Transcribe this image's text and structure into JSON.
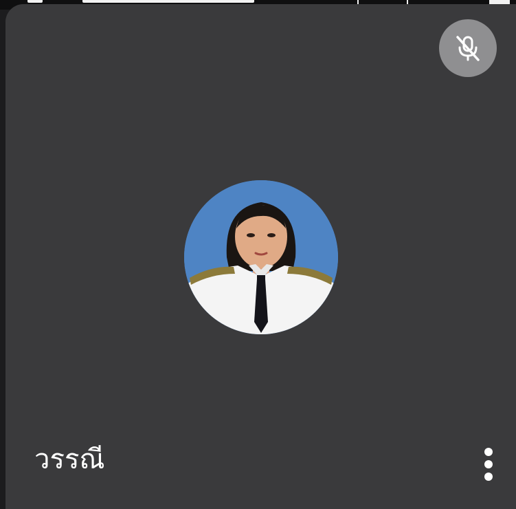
{
  "participant": {
    "name": "วรรณี",
    "muted": true,
    "avatar": "profile-photo"
  },
  "icons": {
    "mute": "mic-off-icon",
    "more": "more-vertical-icon"
  },
  "colors": {
    "tile_background": "#3a3a3c",
    "mute_badge": "#8f8f91",
    "avatar_background": "#4e84c4",
    "text": "#ffffff"
  }
}
